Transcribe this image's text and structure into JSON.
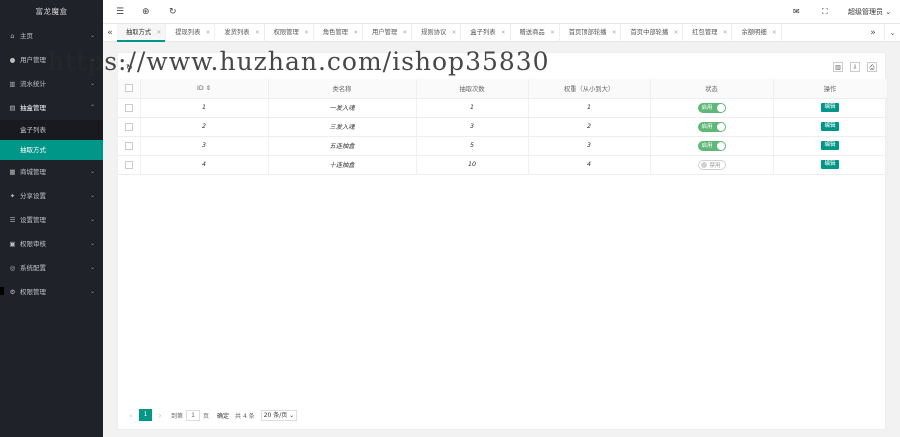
{
  "sidebar": {
    "logo": "富龙魔盒",
    "items": [
      {
        "label": "主页",
        "icon": "home-icon",
        "glyph": "⌂",
        "arrow": "⌄"
      },
      {
        "label": "用户管理",
        "icon": "user-icon",
        "glyph": "●",
        "arrow": "⌄"
      },
      {
        "label": "流水统计",
        "icon": "chart-icon",
        "glyph": "▥",
        "arrow": "⌄"
      },
      {
        "label": "抽盒管理",
        "icon": "box-icon",
        "glyph": "▤",
        "arrow": "⌃",
        "open": true,
        "children": [
          {
            "label": "盒子列表",
            "active": false
          },
          {
            "label": "抽取方式",
            "active": true
          }
        ]
      },
      {
        "label": "商城管理",
        "icon": "shop-icon",
        "glyph": "▦",
        "arrow": "⌄"
      },
      {
        "label": "分享设置",
        "icon": "share-icon",
        "glyph": "✦",
        "arrow": "⌄"
      },
      {
        "label": "设置管理",
        "icon": "settings-icon",
        "glyph": "☰",
        "arrow": "⌄"
      },
      {
        "label": "权限审核",
        "icon": "audit-icon",
        "glyph": "▣",
        "arrow": "⌄"
      },
      {
        "label": "系统配置",
        "icon": "config-icon",
        "glyph": "◎",
        "arrow": "⌄"
      },
      {
        "label": "权限管理",
        "icon": "permission-icon",
        "glyph": "⚙",
        "arrow": "⌄"
      }
    ]
  },
  "header": {
    "icons": [
      "menu-icon",
      "globe-icon",
      "refresh-icon"
    ],
    "right": {
      "user": "超级管理员",
      "caret": "⌄"
    }
  },
  "tabs": {
    "items": [
      {
        "label": "抽取方式",
        "active": true
      },
      {
        "label": "提现列表",
        "active": false
      },
      {
        "label": "发货列表",
        "active": false
      },
      {
        "label": "权限管理",
        "active": false
      },
      {
        "label": "角色管理",
        "active": false
      },
      {
        "label": "用户管理",
        "active": false
      },
      {
        "label": "规则协议",
        "active": false
      },
      {
        "label": "盒子列表",
        "active": false
      },
      {
        "label": "赠送商品",
        "active": false
      },
      {
        "label": "首页顶部轮播",
        "active": false
      },
      {
        "label": "首页中部轮播",
        "active": false
      },
      {
        "label": "红包管理",
        "active": false
      },
      {
        "label": "余额明细",
        "active": false
      }
    ]
  },
  "table": {
    "headers": [
      "ID ⇕",
      "类名称",
      "抽取次数",
      "权重（从小到大）",
      "状态",
      "操作"
    ],
    "rows": [
      {
        "id": "1",
        "name": "一发入魂",
        "count": "1",
        "weight": "1",
        "status": "on",
        "status_label": "启用",
        "action": "编辑"
      },
      {
        "id": "2",
        "name": "三发入魂",
        "count": "3",
        "weight": "2",
        "status": "on",
        "status_label": "启用",
        "action": "编辑"
      },
      {
        "id": "3",
        "name": "五连抽盒",
        "count": "5",
        "weight": "3",
        "status": "on",
        "status_label": "启用",
        "action": "编辑"
      },
      {
        "id": "4",
        "name": "十连抽盒",
        "count": "10",
        "weight": "4",
        "status": "off",
        "status_label": "禁用",
        "action": "编辑"
      }
    ]
  },
  "pagination": {
    "current": "1",
    "goto_label": "到第",
    "input": "1",
    "page_label": "页",
    "ok_label": "确定",
    "total": "共 4 条",
    "size": "20 条/页"
  },
  "watermark": "https://www.huzhan.com/ishop35830",
  "colors": {
    "accent": "#009688",
    "sidebar": "#20222a",
    "switch_on": "#5fb878"
  }
}
